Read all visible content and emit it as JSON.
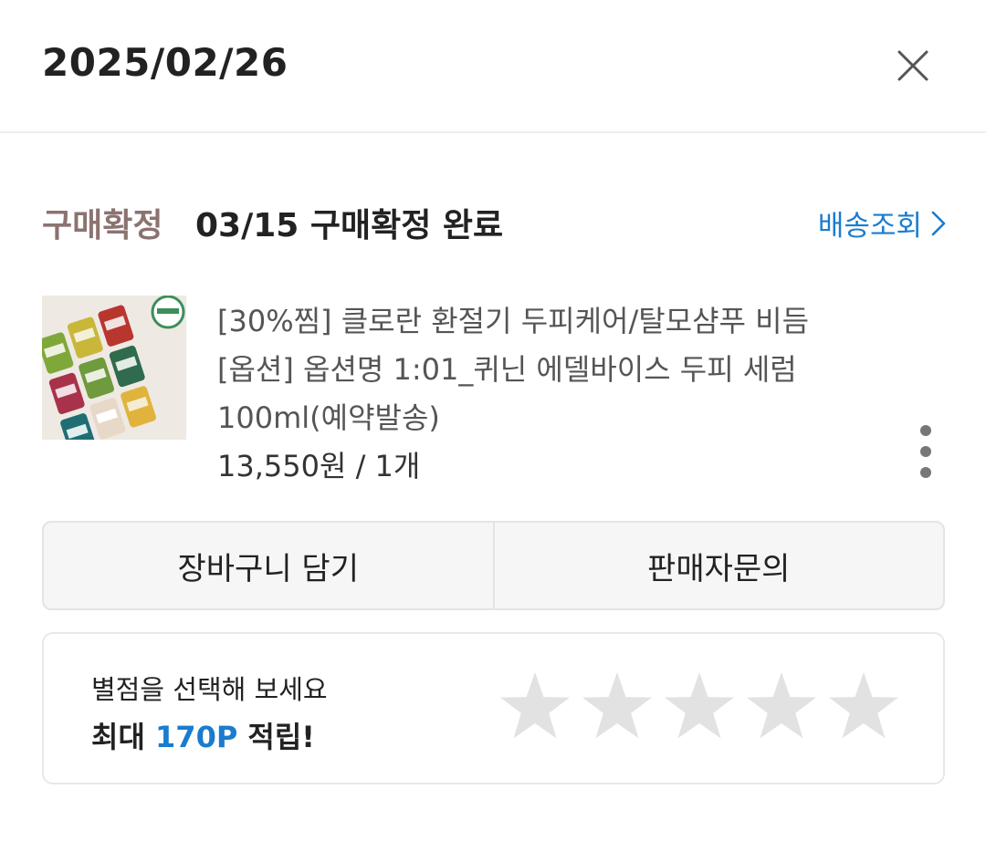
{
  "header": {
    "date": "2025/02/26",
    "close_icon": "close-icon"
  },
  "status": {
    "label": "구매확정",
    "text": "03/15 구매확정 완료",
    "tracking_label": "배송조회",
    "tracking_icon": "chevron-right-icon"
  },
  "product": {
    "line1": "[30%찜] 클로란 환절기 두피케어/탈모샴푸 비듬",
    "line2": "[옵션] 옵션명 1:01_퀴닌 에델바이스 두피 세럼",
    "line3": "100ml(예약발송)",
    "price_qty": "13,550원 / 1개",
    "more_icon": "more-vertical-icon"
  },
  "actions": {
    "cart_label": "장바구니 담기",
    "inquiry_label": "판매자문의"
  },
  "rating": {
    "prompt": "별점을 선택해 보세요",
    "reward_prefix": "최대 ",
    "reward_points": "170P",
    "reward_suffix": " 적립!",
    "star_count": 5,
    "selected_stars": 0
  },
  "colors": {
    "status_label": "#8c7370",
    "link_blue": "#1a7ccf",
    "star_empty": "#e2e2e2"
  }
}
